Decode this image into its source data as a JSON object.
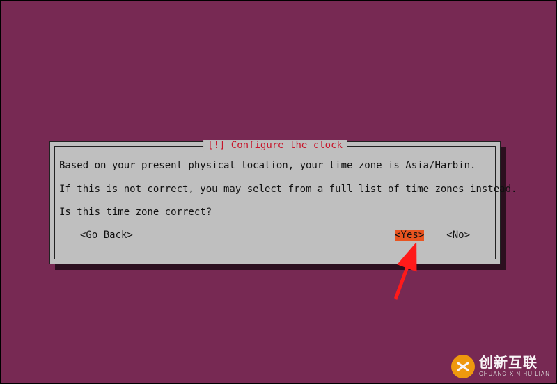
{
  "dialog": {
    "title": "[!] Configure the clock",
    "line1": "Based on your present physical location, your time zone is Asia/Harbin.",
    "line2": "If this is not correct, you may select from a full list of time zones instead.",
    "question": "Is this time zone correct?",
    "buttons": {
      "go_back": "<Go Back>",
      "yes": "<Yes>",
      "no": "<No>"
    },
    "selected": "yes"
  },
  "watermark": {
    "cn": "创新互联",
    "en": "CHUANG XIN HU LIAN"
  },
  "colors": {
    "background": "#772953",
    "panel": "#bfbfbf",
    "accent_red": "#c7162b",
    "highlight": "#e95420"
  }
}
